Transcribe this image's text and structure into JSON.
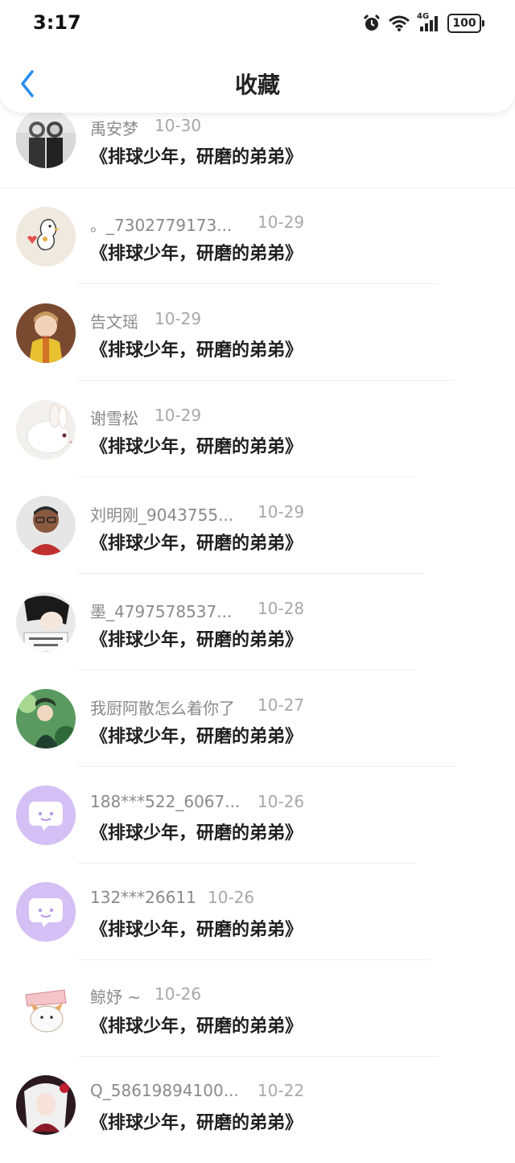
{
  "status": {
    "time": "3:17",
    "network": "4G",
    "battery": "100"
  },
  "header": {
    "title": "收藏"
  },
  "items": [
    {
      "name": "禹安梦",
      "date": "10-30",
      "title": "《排球少年，研磨的弟弟》",
      "avatar": "bw-kids-photo"
    },
    {
      "name": "。_7302779173...",
      "date": "10-29",
      "title": "《排球少年，研磨的弟弟》",
      "avatar": "duck-doodle"
    },
    {
      "name": "告文瑶",
      "date": "10-29",
      "title": "《排球少年，研磨的弟弟》",
      "avatar": "girl-yellow-dress"
    },
    {
      "name": "谢雪松",
      "date": "10-29",
      "title": "《排球少年，研磨的弟弟》",
      "avatar": "white-rabbit"
    },
    {
      "name": "刘明刚_9043755...",
      "date": "10-29",
      "title": "《排球少年，研磨的弟弟》",
      "avatar": "man-glasses"
    },
    {
      "name": "墨_4797578537...",
      "date": "10-28",
      "title": "《排球少年，研磨的弟弟》",
      "avatar": "anime-boy"
    },
    {
      "name": "我厨阿散怎么着你了",
      "date": "10-27",
      "title": "《排球少年，研磨的弟弟》",
      "avatar": "green-character"
    },
    {
      "name": "188***522_6067...",
      "date": "10-26",
      "title": "《排球少年，研磨的弟弟》",
      "avatar": "purple-chat-default"
    },
    {
      "name": "132***26611",
      "date": "10-26",
      "title": "《排球少年，研磨的弟弟》",
      "avatar": "purple-chat-default"
    },
    {
      "name": "鲸妤 ~",
      "date": "10-26",
      "title": "《排球少年，研磨的弟弟》",
      "avatar": "cat-sticker"
    },
    {
      "name": "Q_58619894100...",
      "date": "10-22",
      "title": "《排球少年，研磨的弟弟》",
      "avatar": "anime-white-hair"
    }
  ]
}
